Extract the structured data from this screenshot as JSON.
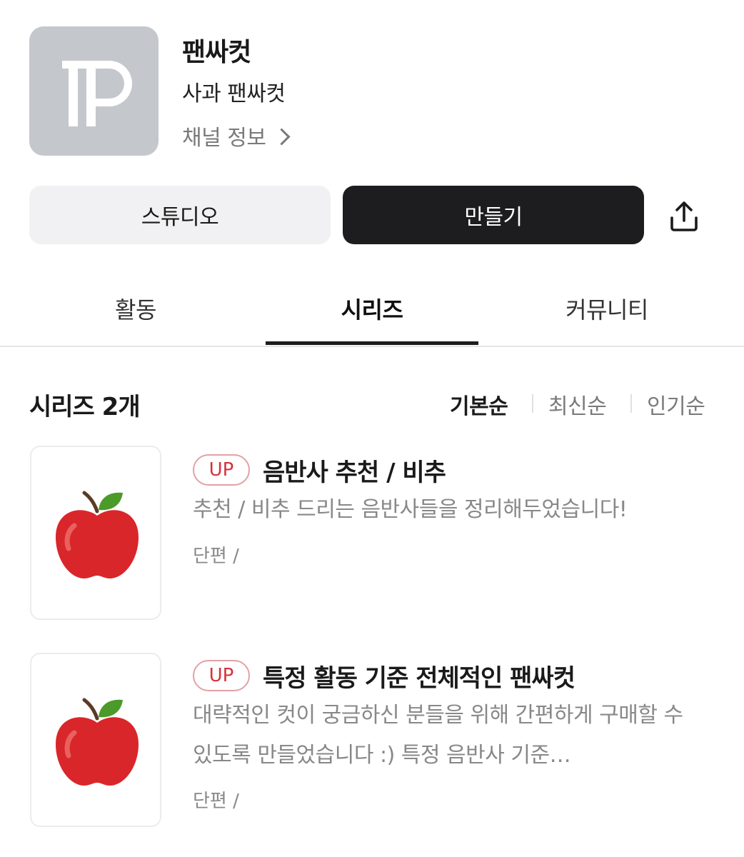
{
  "channel": {
    "name": "팬싸컷",
    "subtitle": "사과 팬싸컷",
    "info_link": "채널 정보"
  },
  "actions": {
    "studio_label": "스튜디오",
    "create_label": "만들기"
  },
  "tabs": [
    {
      "label": "활동"
    },
    {
      "label": "시리즈"
    },
    {
      "label": "커뮤니티"
    }
  ],
  "series_list": {
    "count_label": "시리즈 2개",
    "sort_options": [
      {
        "label": "기본순"
      },
      {
        "label": "최신순"
      },
      {
        "label": "인기순"
      }
    ],
    "items": [
      {
        "badge": "UP",
        "title": "음반사 추천 / 비추",
        "description": "추천 / 비추 드리는 음반사들을 정리해두었습니다!",
        "meta": "단편 /"
      },
      {
        "badge": "UP",
        "title": "특정 활동 기준 전체적인 팬싸컷",
        "description": "대략적인 컷이 궁금하신 분들을 위해 간편하게 구매할 수 있도록 만들었습니다 :) 특정 음반사 기준…",
        "meta": "단편 /"
      }
    ]
  },
  "colors": {
    "avatar_bg": "#c4c7cc",
    "primary_button": "#1d1d1f",
    "badge_red": "#d6323b"
  }
}
